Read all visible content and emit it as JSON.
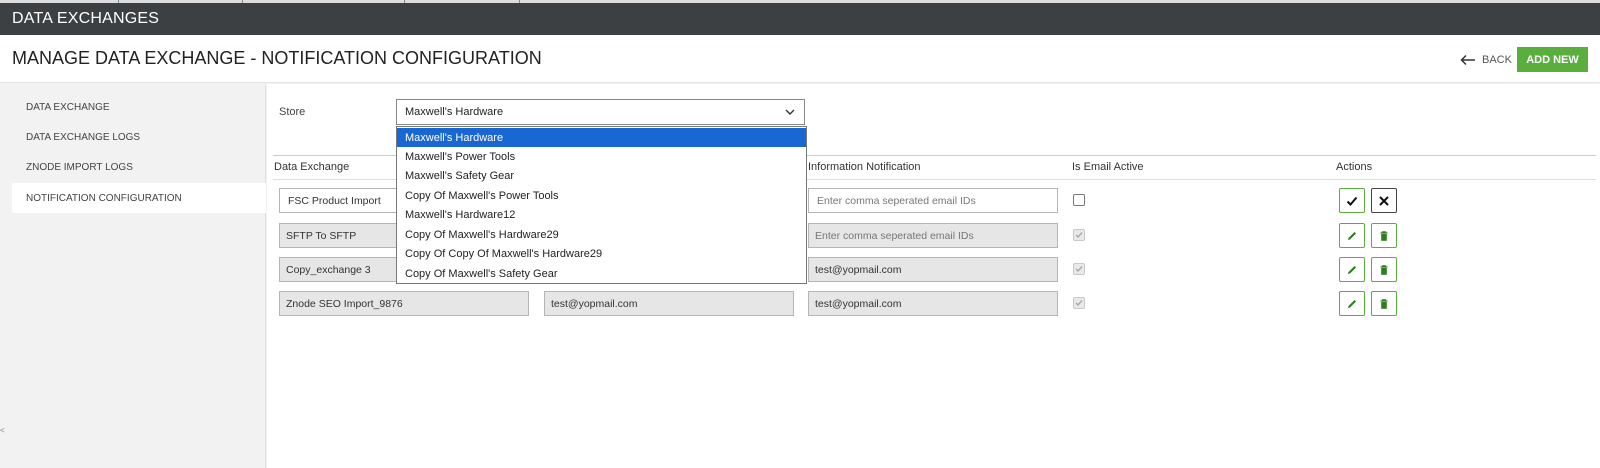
{
  "topbar": {
    "title": "DATA EXCHANGES"
  },
  "header": {
    "title": "MANAGE DATA EXCHANGE - NOTIFICATION CONFIGURATION",
    "back_label": "BACK",
    "add_label": "ADD NEW"
  },
  "sidebar": {
    "items": [
      {
        "label": "DATA EXCHANGE",
        "active": false
      },
      {
        "label": "DATA EXCHANGE LOGS",
        "active": false
      },
      {
        "label": "ZNODE IMPORT LOGS",
        "active": false
      },
      {
        "label": "NOTIFICATION CONFIGURATION",
        "active": true
      }
    ]
  },
  "store": {
    "label": "Store",
    "selected": "Maxwell's Hardware",
    "options": [
      "Maxwell's Hardware",
      "Maxwell's Power Tools",
      "Maxwell's Safety Gear",
      "Copy Of Maxwell's Power Tools",
      "Maxwell's Hardware12",
      "Copy Of Maxwell's Hardware29",
      "Copy Of Copy Of Maxwell's Hardware29",
      "Copy Of Maxwell's Safety Gear"
    ]
  },
  "table": {
    "headers": {
      "data_exchange": "Data Exchange",
      "information_notification": "Information Notification",
      "is_email_active": "Is Email Active",
      "actions": "Actions"
    },
    "rows": [
      {
        "exchange": "FSC Product Import",
        "error_email": "",
        "info_email": "",
        "info_placeholder": "Enter comma seperated email IDs",
        "active": false,
        "editing": true
      },
      {
        "exchange": "SFTP To SFTP",
        "error_email": "",
        "info_email": "",
        "info_placeholder": "Enter comma seperated email IDs",
        "active": true,
        "editing": false
      },
      {
        "exchange": "Copy_exchange 3",
        "error_email": "",
        "info_email": "test@yopmail.com",
        "info_placeholder": "",
        "active": true,
        "editing": false
      },
      {
        "exchange": "Znode SEO Import_9876",
        "error_email": "test@yopmail.com",
        "info_email": "test@yopmail.com",
        "info_placeholder": "",
        "active": true,
        "editing": false
      }
    ]
  },
  "colors": {
    "topbar": "#3d4043",
    "accent_green": "#5aae3e",
    "dropdown_selected": "#1967d2"
  },
  "icons": [
    "arrow-left-icon",
    "chevron-down-icon",
    "check-icon",
    "close-icon",
    "pencil-icon",
    "trash-icon"
  ]
}
